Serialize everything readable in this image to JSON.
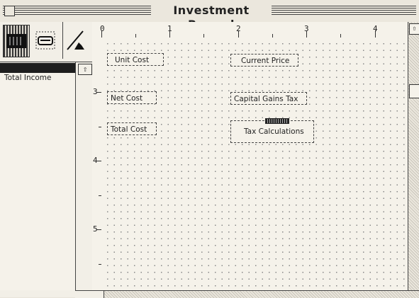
{
  "window": {
    "title": "Investment Record"
  },
  "palette": {
    "tools": [
      {
        "icon": "field-tool-icon"
      },
      {
        "icon": "button-tool-icon"
      },
      {
        "icon": "line-tool-icon"
      }
    ]
  },
  "list": {
    "items": [
      {
        "label": "",
        "selected": true
      },
      {
        "label": "Total Income",
        "selected": false
      }
    ]
  },
  "ruler": {
    "horizontal": [
      "0",
      "1",
      "2",
      "3",
      "4"
    ],
    "vertical": [
      "3",
      "4",
      "5"
    ]
  },
  "fields": {
    "unit_cost": "Unit Cost",
    "current_price": "Current Price",
    "net_cost": "Net Cost",
    "capital_gains_tax": "Capital Gains Tax",
    "total_cost": "Total Cost",
    "tax_calculations": "Tax Calculations"
  }
}
